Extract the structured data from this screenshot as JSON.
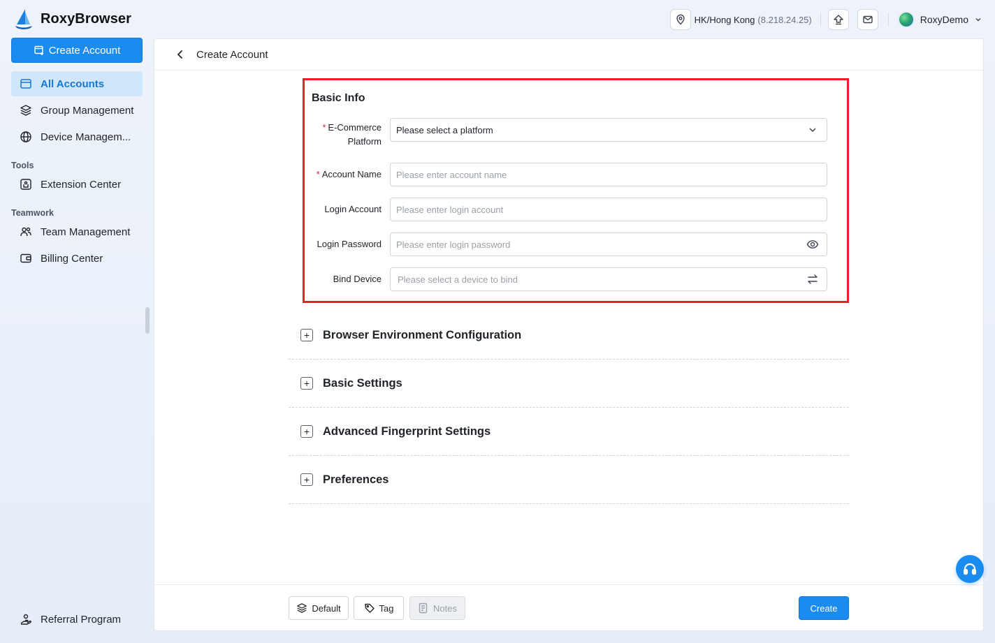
{
  "app": {
    "name": "RoxyBrowser"
  },
  "header": {
    "location": "HK/Hong Kong",
    "ip": "(8.218.24.25)",
    "user_name": "RoxyDemo"
  },
  "sidebar": {
    "create_button": "Create Account",
    "items": [
      {
        "label": "All Accounts",
        "icon": "accounts-icon",
        "active": true
      },
      {
        "label": "Group Management",
        "icon": "layers-icon"
      },
      {
        "label": "Device Managem...",
        "icon": "globe-icon"
      }
    ],
    "tools_label": "Tools",
    "tools": [
      {
        "label": "Extension Center",
        "icon": "extension-icon"
      }
    ],
    "teamwork_label": "Teamwork",
    "teamwork": [
      {
        "label": "Team Management",
        "icon": "team-icon"
      },
      {
        "label": "Billing Center",
        "icon": "wallet-icon"
      }
    ],
    "referral": "Referral Program"
  },
  "page": {
    "title": "Create Account",
    "basic_info": {
      "title": "Basic Info",
      "platform_label_line1": "E-Commerce",
      "platform_label_line2": "Platform",
      "platform_value": "Please select a platform",
      "account_name_label": "Account Name",
      "account_name_placeholder": "Please enter account name",
      "login_account_label": "Login Account",
      "login_account_placeholder": "Please enter login account",
      "login_password_label": "Login Password",
      "login_password_placeholder": "Please enter login password",
      "bind_device_label": "Bind Device",
      "bind_device_placeholder": "Please select a device to bind"
    },
    "sections": [
      "Browser Environment Configuration",
      "Basic Settings",
      "Advanced Fingerprint Settings",
      "Preferences"
    ],
    "footer": {
      "default_label": "Default",
      "tag_label": "Tag",
      "notes_label": "Notes",
      "create_label": "Create"
    }
  },
  "colors": {
    "accent": "#1a8cf0",
    "highlight_box": "#e8202a"
  }
}
